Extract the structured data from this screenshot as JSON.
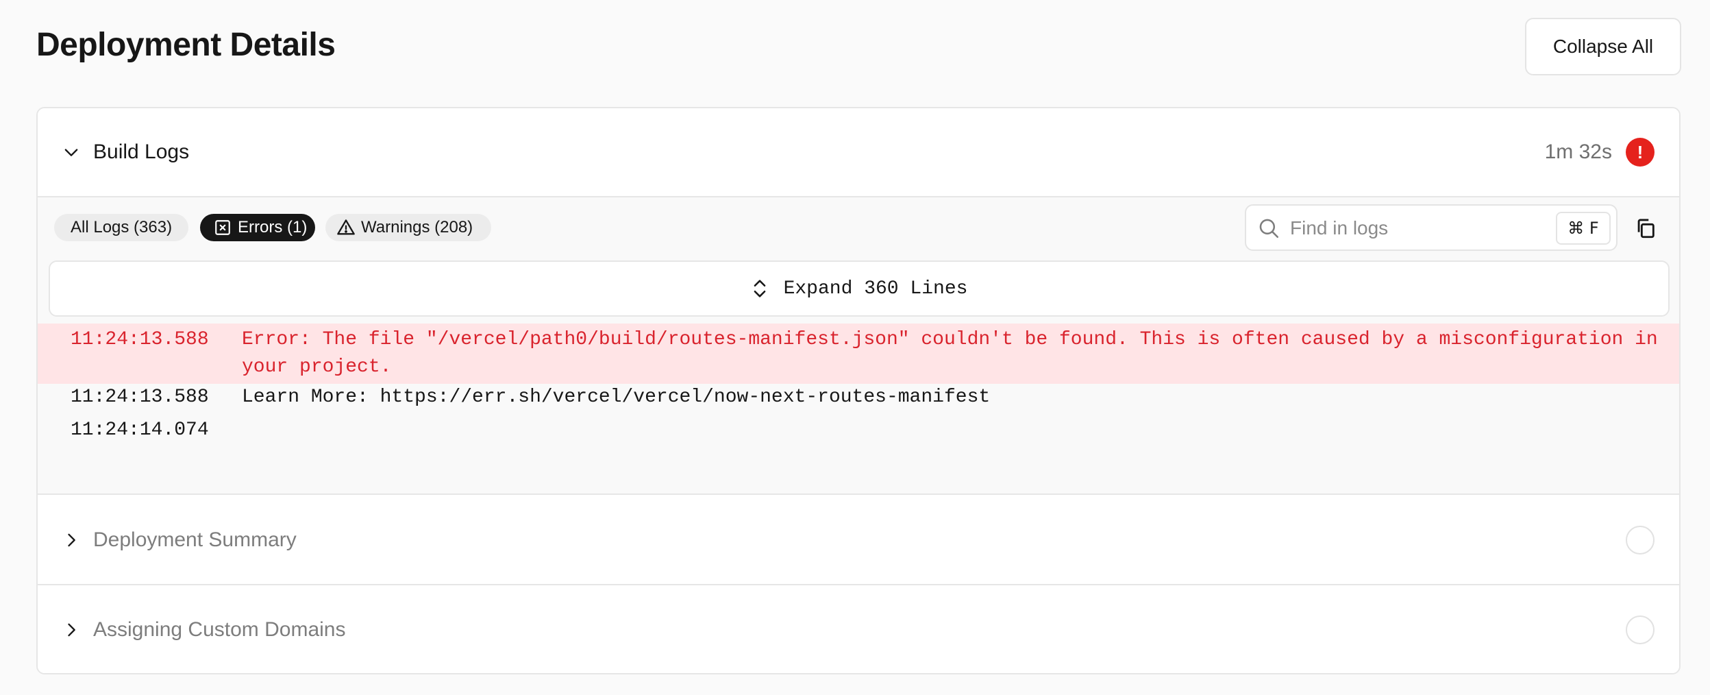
{
  "page": {
    "title": "Deployment Details",
    "collapse_all_label": "Collapse All"
  },
  "build_logs": {
    "title": "Build Logs",
    "duration": "1m 32s",
    "status_icon": "error-exclamation",
    "status_glyph": "!",
    "filters": [
      {
        "label": "All Logs (363)",
        "active": false
      },
      {
        "label": "Errors (1)",
        "active": true,
        "icon": "x-square-icon"
      },
      {
        "label": "Warnings (208)",
        "active": false,
        "icon": "warning-triangle-icon"
      }
    ],
    "search": {
      "placeholder": "Find in logs",
      "value": "",
      "shortcut": "⌘ F"
    },
    "expand_label": "Expand 360 Lines",
    "lines": [
      {
        "time": "11:24:13.588",
        "message": "Error: The file \"/vercel/path0/build/routes-manifest.json\" couldn't be found. This is often caused by a misconfiguration in your project.",
        "level": "error"
      },
      {
        "time": "11:24:13.588",
        "message": "Learn More: https://err.sh/vercel/vercel/now-next-routes-manifest",
        "level": "info"
      },
      {
        "time": "11:24:14.074",
        "message": "",
        "level": "info"
      }
    ]
  },
  "sections": [
    {
      "title": "Deployment Summary",
      "status": "pending"
    },
    {
      "title": "Assigning Custom Domains",
      "status": "pending"
    }
  ],
  "colors": {
    "error_red": "#e5221d",
    "error_row_bg": "#ffe4e6",
    "error_text": "#d9232d",
    "active_pill": "#171717"
  }
}
